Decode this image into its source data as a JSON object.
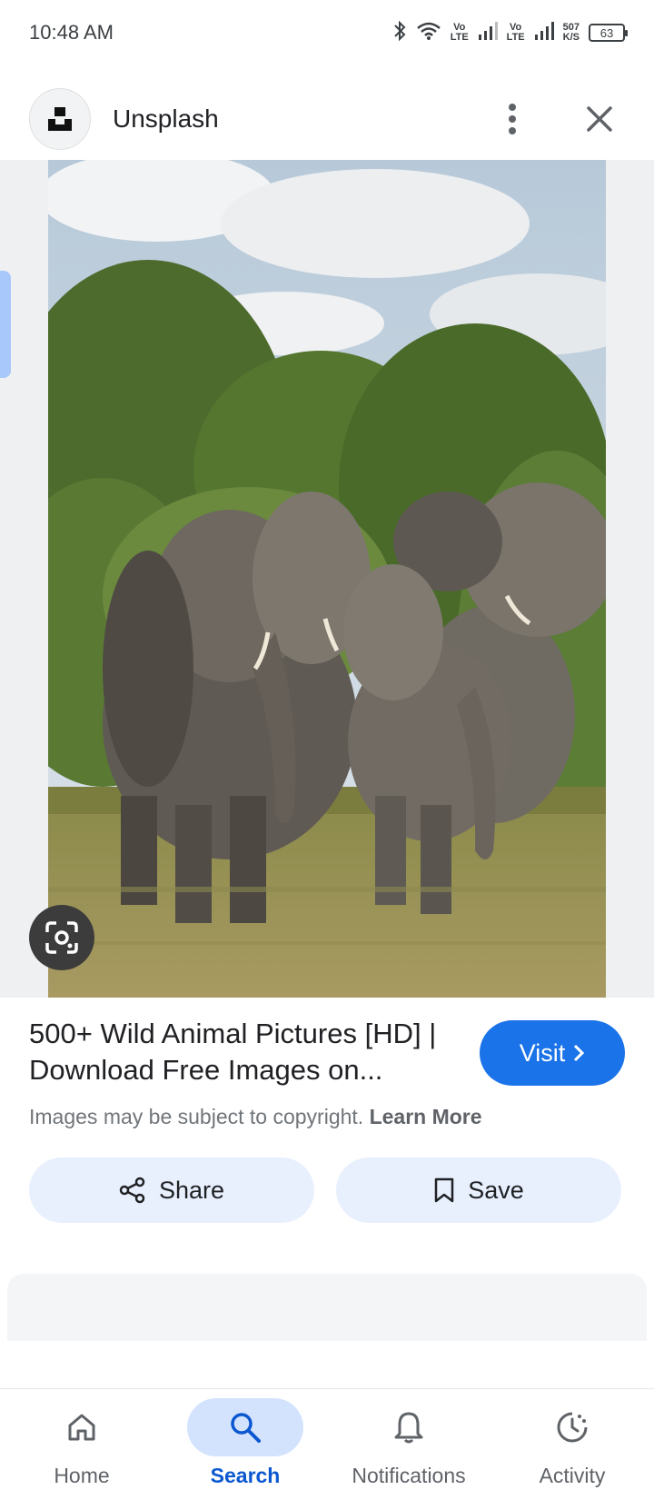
{
  "status_bar": {
    "time": "10:48 AM",
    "net_speed_top": "507",
    "net_speed_bottom": "K/S",
    "battery": "63",
    "volte1_top": "Vo",
    "volte1_bottom": "LTE",
    "volte2_top": "Vo",
    "volte2_bottom": "LTE"
  },
  "header": {
    "site_name": "Unsplash",
    "logo_icon": "unsplash-logo",
    "more_icon": "more-vert-icon",
    "close_icon": "close-icon"
  },
  "result": {
    "title": "500+ Wild Animal Pictures [HD] | Download Free Images on...",
    "visit_label": "Visit",
    "copyright_text": "Images may be subject to copyright.",
    "learn_more": "Learn More"
  },
  "actions": {
    "share_label": "Share",
    "save_label": "Save"
  },
  "bottom_nav": {
    "items": [
      {
        "label": "Home",
        "icon": "home-icon"
      },
      {
        "label": "Search",
        "icon": "search-icon",
        "active": true
      },
      {
        "label": "Notifications",
        "icon": "bell-icon"
      },
      {
        "label": "Activity",
        "icon": "activity-icon"
      }
    ]
  },
  "colors": {
    "accent": "#1a73e8",
    "active_nav": "#0b57d0",
    "pill_bg": "#e8f0fe"
  }
}
